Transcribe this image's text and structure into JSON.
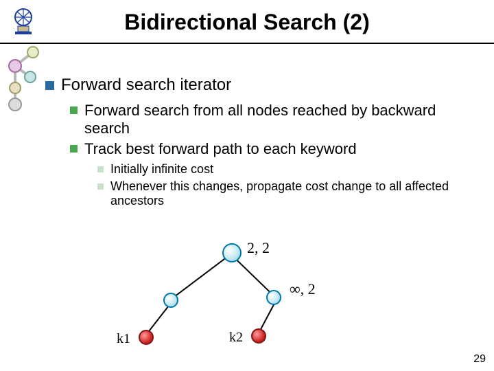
{
  "title": "Bidirectional Search (2)",
  "bullets": {
    "l1": "Forward search iterator",
    "l2a": "Forward search from all nodes reached by backward search",
    "l2b": "Track best forward path to each keyword",
    "l3a": "Initially infinite cost",
    "l3b": "Whenever this changes, propagate cost change to all affected ancestors"
  },
  "diagram": {
    "root_label": "2, 2",
    "right_label": "∞, 2",
    "k1": "k1",
    "k2": "k2"
  },
  "page_number": "29"
}
